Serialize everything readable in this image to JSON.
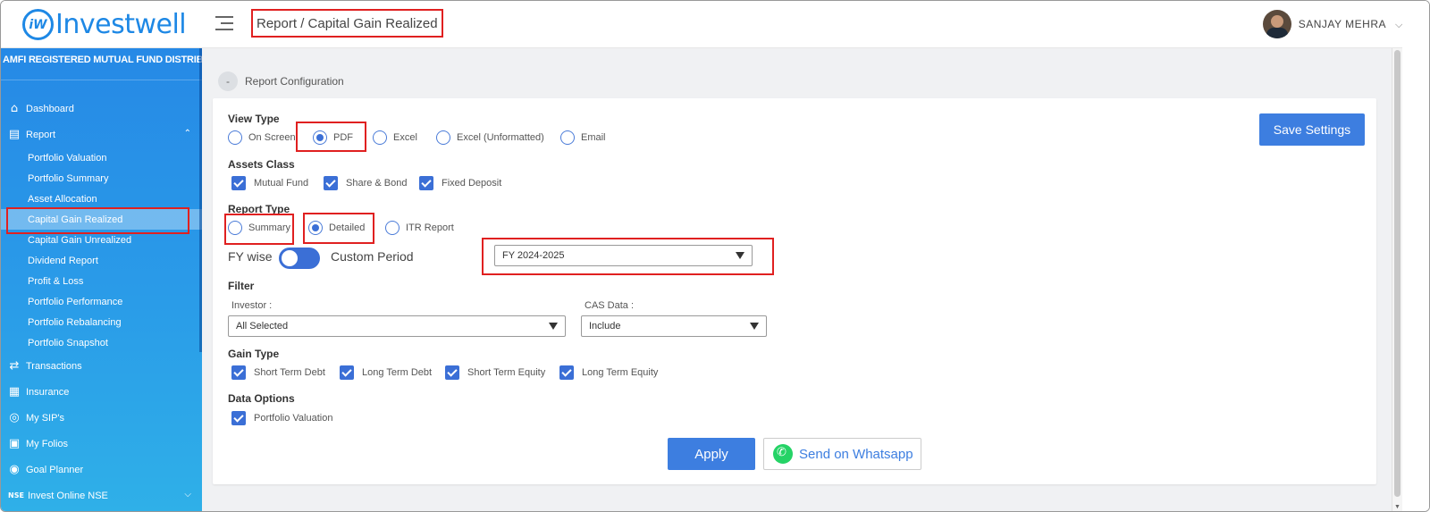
{
  "app": {
    "brand": "Investwell",
    "logo_mark": "iW"
  },
  "header": {
    "breadcrumb": "Report / Capital Gain Realized",
    "user_name": "SANJAY MEHRA"
  },
  "sidebar": {
    "tagline": "AMFI REGISTERED MUTUAL FUND DISTRIBUTOR",
    "items": [
      {
        "label": "Dashboard",
        "icon": "home-icon"
      },
      {
        "label": "Report",
        "icon": "report-icon"
      },
      {
        "label": "Transactions",
        "icon": "swap-icon"
      },
      {
        "label": "Insurance",
        "icon": "document-icon"
      },
      {
        "label": "My SIP's",
        "icon": "sip-icon"
      },
      {
        "label": "My Folios",
        "icon": "folio-icon"
      },
      {
        "label": "Goal Planner",
        "icon": "target-icon"
      },
      {
        "label": "Invest Online NSE",
        "icon": "nse-icon",
        "icon_text": "NSE"
      }
    ],
    "report_sub": [
      "Portfolio Valuation",
      "Portfolio Summary",
      "Asset Allocation",
      "Capital Gain Realized",
      "Capital Gain Unrealized",
      "Dividend Report",
      "Profit & Loss",
      "Portfolio Performance",
      "Portfolio Rebalancing",
      "Portfolio Snapshot"
    ]
  },
  "config": {
    "title": "Report Configuration",
    "collapse_symbol": "-",
    "save_label": "Save Settings",
    "view_type": {
      "label": "View Type",
      "options": [
        "On Screen",
        "PDF",
        "Excel",
        "Excel (Unformatted)",
        "Email"
      ],
      "selected": "PDF"
    },
    "assets_class": {
      "label": "Assets Class",
      "options": [
        "Mutual Fund",
        "Share & Bond",
        "Fixed Deposit"
      ]
    },
    "report_type": {
      "label": "Report Type",
      "options": [
        "Summary",
        "Detailed",
        "ITR Report"
      ],
      "selected": "Detailed"
    },
    "period": {
      "left_label": "FY wise",
      "right_label": "Custom Period",
      "fy_value": "FY 2024-2025"
    },
    "filter": {
      "label": "Filter",
      "investor_label": "Investor :",
      "investor_value": "All Selected",
      "cas_label": "CAS Data :",
      "cas_value": "Include"
    },
    "gain_type": {
      "label": "Gain Type",
      "options": [
        "Short Term Debt",
        "Long Term Debt",
        "Short Term Equity",
        "Long Term Equity"
      ]
    },
    "data_options": {
      "label": "Data Options",
      "options": [
        "Portfolio Valuation"
      ]
    },
    "apply_label": "Apply",
    "whatsapp_label": "Send on Whatsapp"
  },
  "colors": {
    "primary": "#3d7ee0",
    "sidebar_top": "#2689e6",
    "sidebar_bottom": "#2fb0e8",
    "highlight": "#e02020"
  }
}
